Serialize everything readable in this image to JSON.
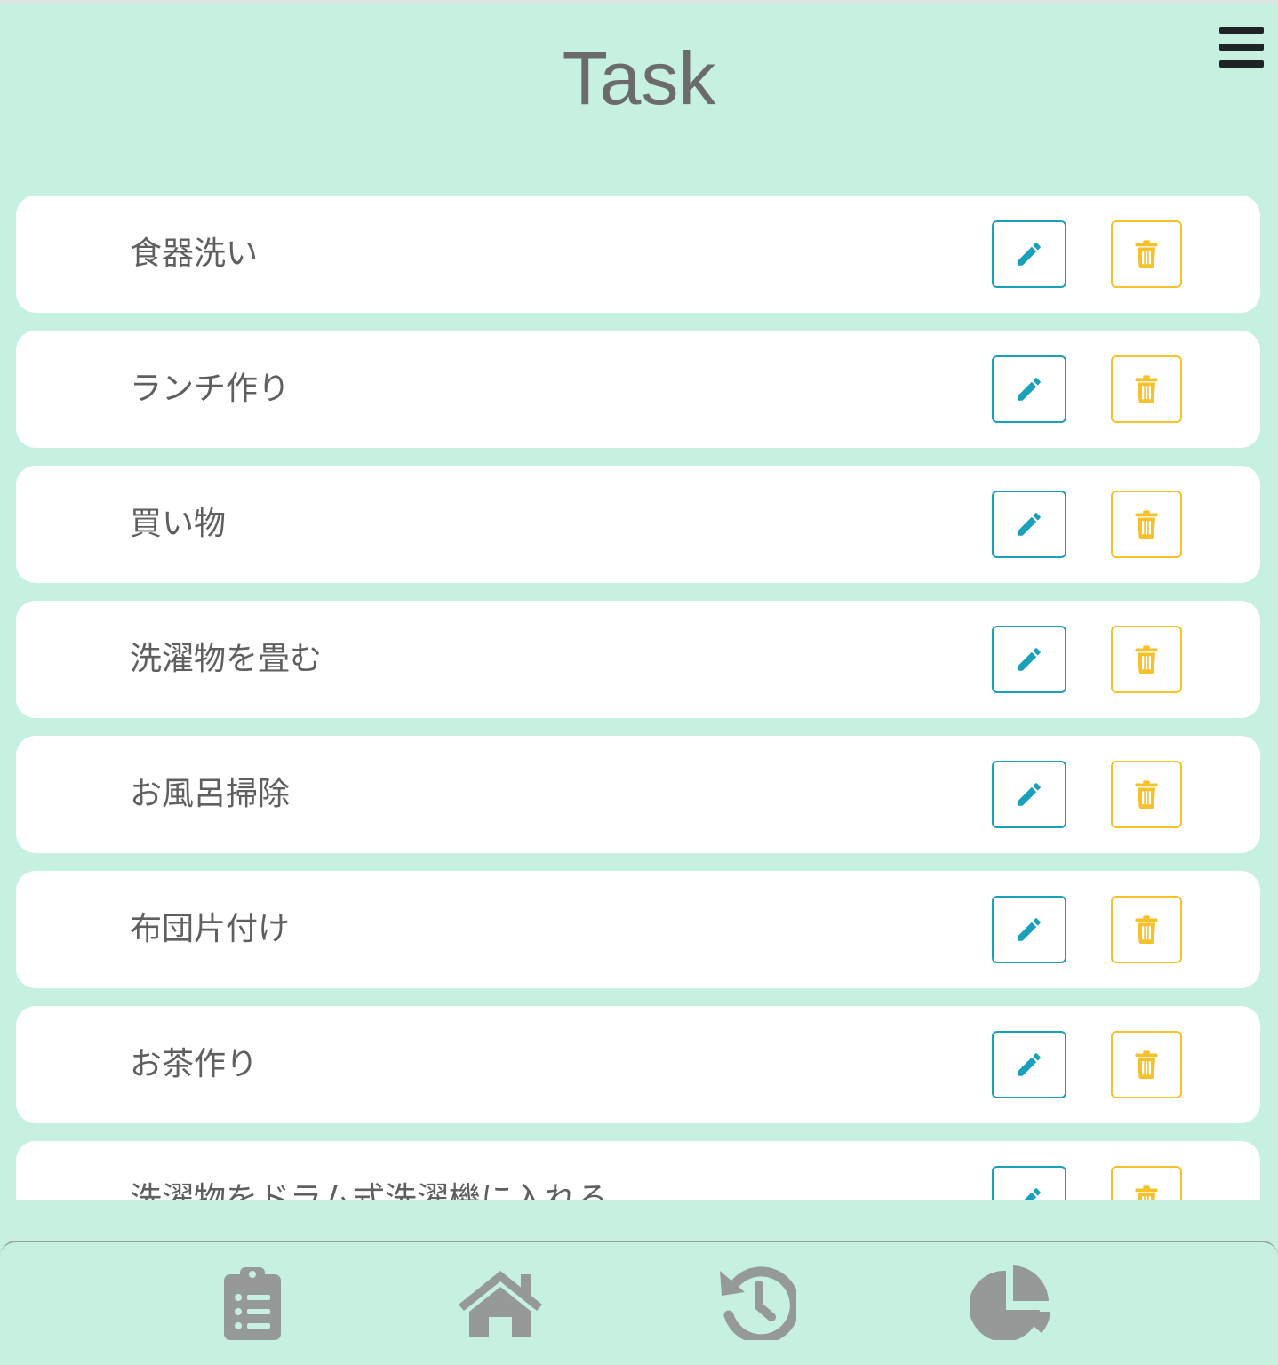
{
  "header": {
    "title": "Task",
    "menu_icon": "hamburger-menu-icon"
  },
  "tasks": [
    {
      "label": "食器洗い"
    },
    {
      "label": "ランチ作り"
    },
    {
      "label": "買い物"
    },
    {
      "label": "洗濯物を畳む"
    },
    {
      "label": "お風呂掃除"
    },
    {
      "label": "布団片付け"
    },
    {
      "label": "お茶作り"
    },
    {
      "label": "洗濯物をドラム式洗濯機に入れる"
    }
  ],
  "task_actions": {
    "edit_icon": "pencil-icon",
    "delete_icon": "trash-icon"
  },
  "bottom_nav": [
    {
      "icon": "clipboard-list-icon"
    },
    {
      "icon": "home-icon"
    },
    {
      "icon": "history-icon"
    },
    {
      "icon": "pie-chart-icon"
    }
  ],
  "colors": {
    "background": "#c6f0e0",
    "card": "#ffffff",
    "edit_accent": "#1aa0ba",
    "delete_accent": "#f6c12b",
    "nav_icon": "#959a98",
    "title_text": "#6b6b6b"
  }
}
